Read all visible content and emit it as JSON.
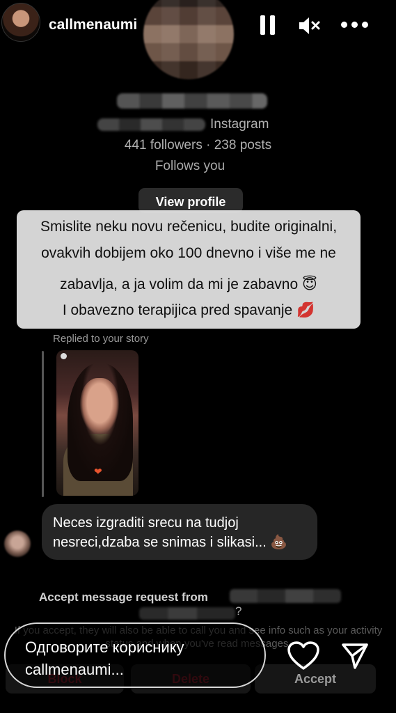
{
  "story_header": {
    "username": "callmenaumi",
    "icons": [
      "pause-icon",
      "mute-icon",
      "more-icon"
    ]
  },
  "profile_card": {
    "platform": "Instagram",
    "stats": "441 followers · 238 posts",
    "follows_label": "Follows you",
    "view_profile_label": "View profile"
  },
  "reply_text": {
    "lines": [
      "Smislite neku novu rečenicu, budite originalni,",
      "ovakvih dobijem oko 100 dnevno i više me ne",
      "zabavlja, a ja volim da mi je zabavno 😇",
      "I obavezno terapijica pred spavanje 💋"
    ]
  },
  "story_reply": {
    "label": "Replied to your story"
  },
  "message": {
    "text": "Neces izgraditi srecu na tudjoj nesreci,dzaba se snimas i slikasi... 💩"
  },
  "accept_panel": {
    "title": "Accept message request from",
    "question_mark": "?",
    "note": "If you accept, they will also be able to call you and see info such as your activity status and when you've read messages.",
    "buttons": {
      "block": "Block",
      "delete": "Delete",
      "accept": "Accept"
    }
  },
  "reply_bar": {
    "placeholder": "Одговорите кориснику callmenaumi..."
  },
  "colors": {
    "background": "#000000",
    "reply_bubble": "#e6e6e6",
    "message_bubble": "#262626",
    "danger_text": "#6a1420"
  }
}
